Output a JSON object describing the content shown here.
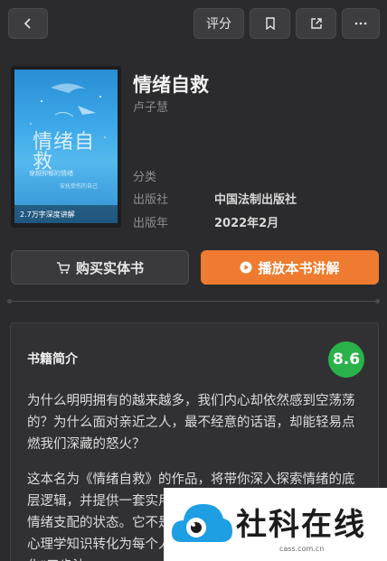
{
  "header": {
    "back_icon": "chevron-left-icon",
    "rate_label": "评分",
    "bookmark_icon": "bookmark-icon",
    "share_icon": "share-icon",
    "more_icon": "more-horizontal-icon"
  },
  "book": {
    "title": "情绪自救",
    "author": "卢子慧",
    "cover": {
      "title": "情绪自救",
      "subtitle": "穿越抑郁的情绪",
      "subtitle2": "安抚受伤的自己",
      "badge": "2.7万字深度讲解"
    },
    "meta": [
      {
        "label": "分类",
        "value": ""
      },
      {
        "label": "出版社",
        "value": "中国法制出版社"
      },
      {
        "label": "出版年",
        "value": "2022年2月"
      }
    ]
  },
  "actions": {
    "buy_label": "购买实体书",
    "play_label": "播放本书讲解",
    "play_color": "#ee7b2f"
  },
  "intro": {
    "heading": "书籍简介",
    "score": "8.6",
    "score_color": "#2ab24a",
    "paragraph1": "为什么明明拥有的越来越多，我们内心却依然感到空荡荡的？为什么面对亲近之人，最不经意的话语，却能轻易点燃我们深藏的怒火？",
    "paragraph2": "这本名为《情绪自救》的作品，将带你深入探索情绪的底层逻辑，并提供一套实用的方法，帮助你从根本上摆脱被情绪支配的状态。它不是枯燥的理论说教，而是将复杂的心理学知识转化为每个人都能掌握的\"觉察、接纳、转化\"三步法。"
  },
  "watermark": {
    "text": "社科在线",
    "url": "cass.com.cn"
  }
}
